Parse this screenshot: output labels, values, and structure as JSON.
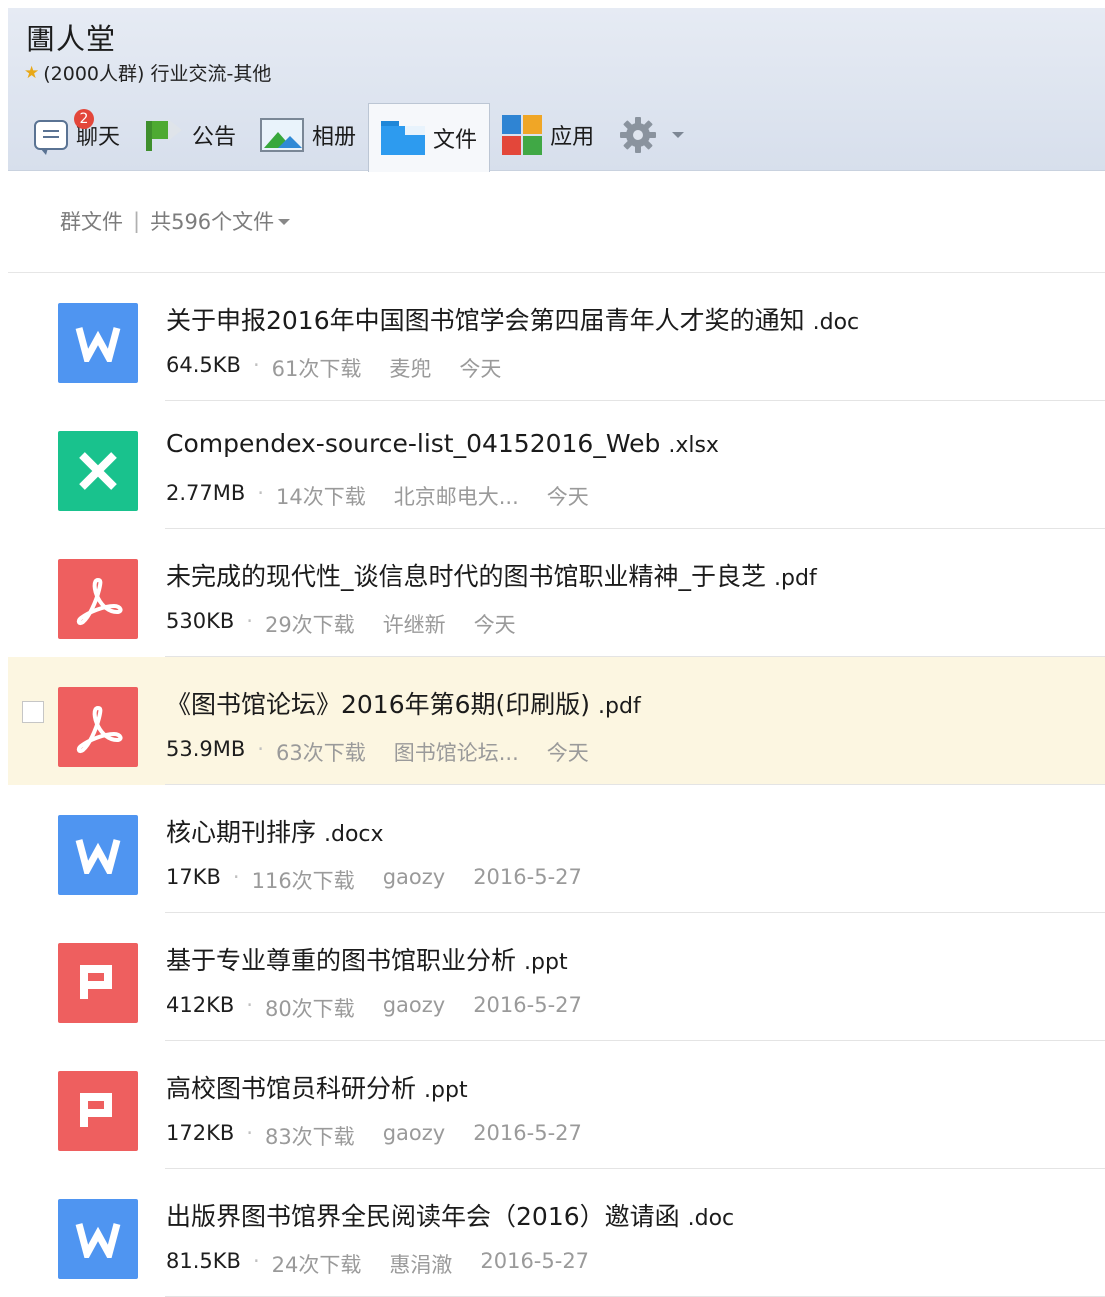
{
  "header": {
    "title": "圕人堂",
    "subtitle": "(2000人群) 行业交流-其他",
    "star_icon": "star-icon",
    "tabs": [
      {
        "label": "聊天",
        "icon": "chat-icon",
        "badge": "2"
      },
      {
        "label": "公告",
        "icon": "announcement-flag-icon"
      },
      {
        "label": "相册",
        "icon": "photo-album-icon"
      },
      {
        "label": "文件",
        "icon": "folder-icon",
        "active": true
      },
      {
        "label": "应用",
        "icon": "apps-icon"
      }
    ],
    "settings_icon": "gear-icon"
  },
  "breadcrumb": {
    "section": "群文件",
    "separator": "|",
    "count_label": "共596个文件"
  },
  "files": [
    {
      "name": "关于申报2016年中国图书馆学会第四届青年人才奖的通知",
      "ext": ".doc",
      "type": "word",
      "size": "64.5KB",
      "downloads": "61次下载",
      "uploader": "麦兜",
      "date": "今天"
    },
    {
      "name": "Compendex-source-list_04152016_Web",
      "ext": ".xlsx",
      "type": "excel",
      "size": "2.77MB",
      "downloads": "14次下载",
      "uploader": "北京邮电大...",
      "date": "今天"
    },
    {
      "name": "未完成的现代性_谈信息时代的图书馆职业精神_于良芝",
      "ext": ".pdf",
      "type": "pdf",
      "size": "530KB",
      "downloads": "29次下载",
      "uploader": "许继新",
      "date": "今天"
    },
    {
      "name": "《图书馆论坛》2016年第6期(印刷版)",
      "ext": ".pdf",
      "type": "pdf",
      "size": "53.9MB",
      "downloads": "63次下载",
      "uploader": "图书馆论坛...",
      "date": "今天",
      "hover": true
    },
    {
      "name": "核心期刊排序",
      "ext": ".docx",
      "type": "word",
      "size": "17KB",
      "downloads": "116次下载",
      "uploader": "gaozy",
      "date": "2016-5-27"
    },
    {
      "name": "基于专业尊重的图书馆职业分析",
      "ext": ".ppt",
      "type": "ppt",
      "size": "412KB",
      "downloads": "80次下载",
      "uploader": "gaozy",
      "date": "2016-5-27"
    },
    {
      "name": "高校图书馆员科研分析",
      "ext": ".ppt",
      "type": "ppt",
      "size": "172KB",
      "downloads": "83次下载",
      "uploader": "gaozy",
      "date": "2016-5-27"
    },
    {
      "name": "出版界图书馆界全民阅读年会（2016）邀请函",
      "ext": ".doc",
      "type": "word",
      "size": "81.5KB",
      "downloads": "24次下载",
      "uploader": "惠涓澈",
      "date": "2016-5-27"
    }
  ],
  "colors": {
    "word": "#4f95f1",
    "excel": "#19c28d",
    "pdf": "#ee5f5f",
    "ppt": "#ee5f5f",
    "hover_row": "#fcf6e1"
  }
}
